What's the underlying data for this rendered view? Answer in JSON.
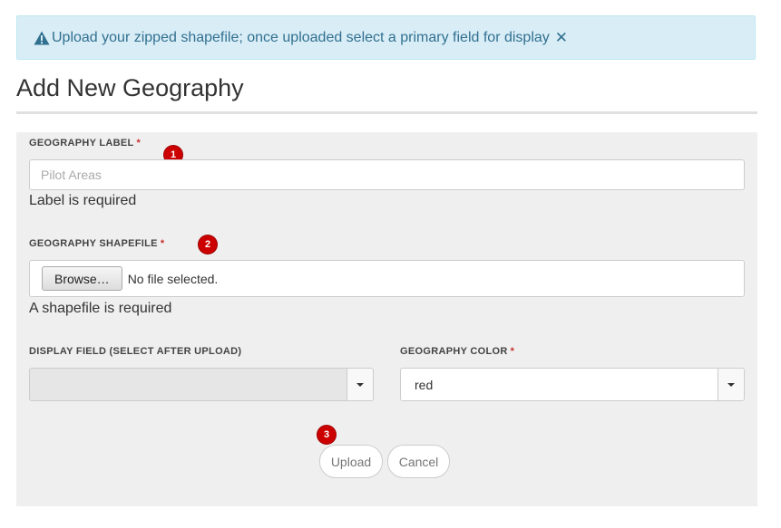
{
  "alert": {
    "message": "Upload your zipped shapefile; once uploaded select a primary field for display",
    "icon": "warning-icon",
    "close_symbol": "✕"
  },
  "page": {
    "title": "Add New Geography"
  },
  "form": {
    "label_field": {
      "label": "GEOGRAPHY LABEL",
      "required_mark": "*",
      "placeholder": "Pilot Areas",
      "value": "",
      "error": "Label is required",
      "step": "1"
    },
    "shapefile_field": {
      "label": "GEOGRAPHY SHAPEFILE",
      "required_mark": "*",
      "browse_label": "Browse…",
      "file_status": "No file selected.",
      "error": "A shapefile is required",
      "step": "2"
    },
    "display_field": {
      "label": "DISPLAY FIELD (SELECT AFTER UPLOAD)",
      "value": "",
      "disabled": true
    },
    "color_field": {
      "label": "GEOGRAPHY COLOR",
      "required_mark": "*",
      "value": "red"
    },
    "actions": {
      "upload_label": "Upload",
      "cancel_label": "Cancel",
      "step": "3"
    }
  },
  "colors": {
    "alert_bg": "#d9edf7",
    "alert_text": "#31708f",
    "badge": "#cc0000",
    "panel_bg": "#efefef",
    "required": "#c9302c"
  }
}
